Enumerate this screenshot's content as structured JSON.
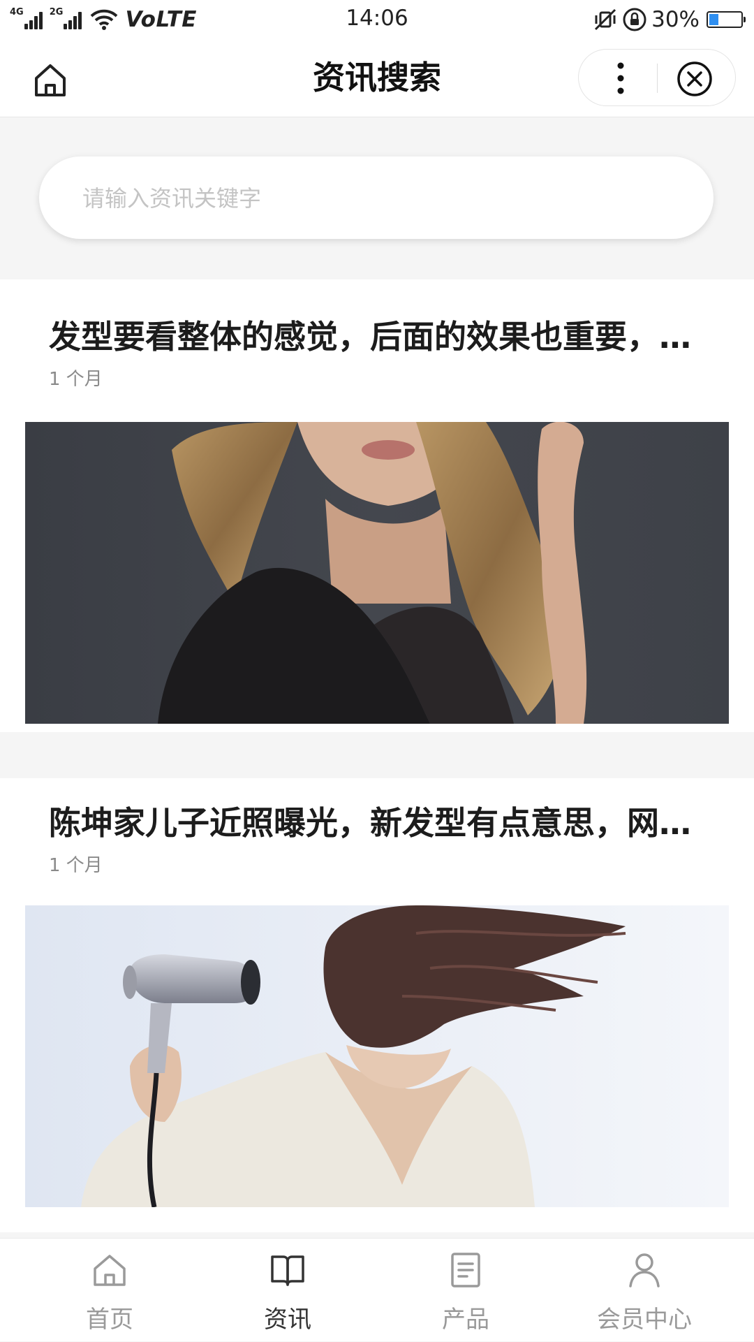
{
  "status_bar": {
    "net_1": "4G",
    "net_2": "2G",
    "volte": "VoLTE",
    "time": "14:06",
    "battery": "30%"
  },
  "nav": {
    "title": "资讯搜索"
  },
  "search": {
    "placeholder": "请输入资讯关键字"
  },
  "articles": [
    {
      "title": "发型要看整体的感觉，后面的效果也重要，...",
      "time": "1 个月"
    },
    {
      "title": "陈坤家儿子近照曝光，新发型有点意思，网...",
      "time": "1 个月"
    }
  ],
  "tabs": [
    {
      "label": "首页",
      "icon": "home-icon",
      "active": false
    },
    {
      "label": "资讯",
      "icon": "book-icon",
      "active": true
    },
    {
      "label": "产品",
      "icon": "document-icon",
      "active": false
    },
    {
      "label": "会员中心",
      "icon": "user-icon",
      "active": false
    }
  ],
  "colors": {
    "active_tab": "#333333",
    "inactive_tab": "#9a9a9a",
    "battery_fill": "#2f8ff0"
  }
}
